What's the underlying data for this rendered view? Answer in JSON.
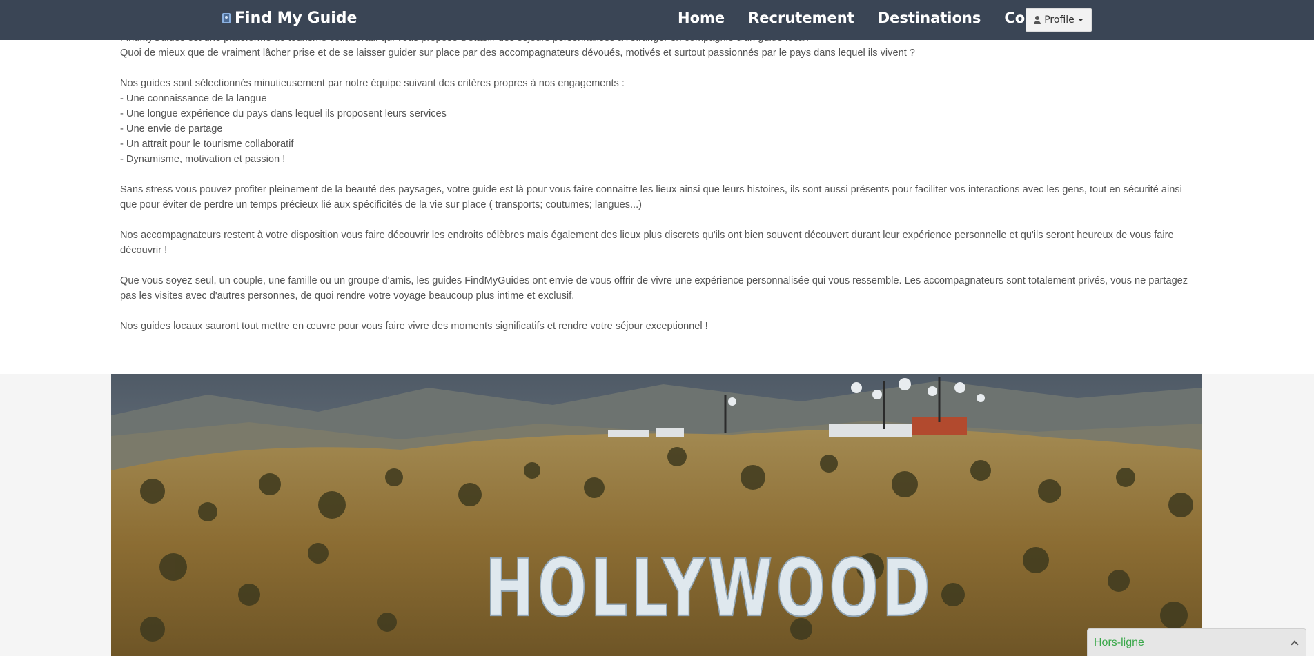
{
  "navbar": {
    "brand": "Find My Guide",
    "links": [
      "Home",
      "Recrutement",
      "Destinations",
      "Contact"
    ],
    "profile_label": "Profile"
  },
  "intro": {
    "line1": "FindMyGuides est une plateforme de tourisme collaboratif qui vous propose d'établir des séjours personnalisés à l'étranger en compagnie d'un guide local.",
    "line2": "Quoi de mieux que de vraiment lâcher prise et de se laisser guider sur place par des accompagnateurs dévoués, motivés et surtout passionnés par le pays dans lequel ils vivent ?"
  },
  "criteria": {
    "heading": "Nos guides sont sélectionnés minutieusement par notre équipe suivant des critères propres à nos engagements :",
    "items": [
      "- Une connaissance de la langue",
      "- Une longue expérience du pays dans lequel ils proposent leurs services",
      "- Une envie de partage",
      "- Un attrait pour le tourisme collaboratif",
      "- Dynamisme, motivation et passion !"
    ]
  },
  "paragraphs": [
    "Sans stress vous pouvez profiter pleinement de la beauté des paysages, votre guide est là pour vous faire connaitre les lieux ainsi que leurs histoires, ils sont aussi présents pour faciliter vos interactions avec les gens, tout en sécurité ainsi que pour éviter de perdre un temps précieux lié aux spécificités de la vie sur place ( transports; coutumes; langues...)",
    "Nos accompagnateurs restent à votre disposition vous faire découvrir les endroits célèbres mais également des lieux plus discrets qu'ils ont bien souvent découvert durant leur expérience personnelle et qu'ils seront heureux de vous faire découvrir !",
    "Que vous soyez seul, un couple, une famille ou un groupe d'amis, les guides FindMyGuides ont envie de vous offrir de vivre une expérience personnalisée qui vous ressemble. Les accompagnateurs sont totalement privés, vous ne partagez pas les visites avec d'autres personnes, de quoi rendre votre voyage beaucoup plus intime et exclusif.",
    "Nos guides locaux sauront tout mettre en œuvre pour vous faire vivre des moments significatifs et rendre votre séjour exceptionnel !"
  ],
  "hero": {
    "sign_text": "HOLLYWOOD"
  },
  "chat": {
    "status": "Hors-ligne"
  },
  "colors": {
    "navbar_bg": "#3a4555",
    "text": "#555555",
    "status_green": "#3aa84a"
  }
}
